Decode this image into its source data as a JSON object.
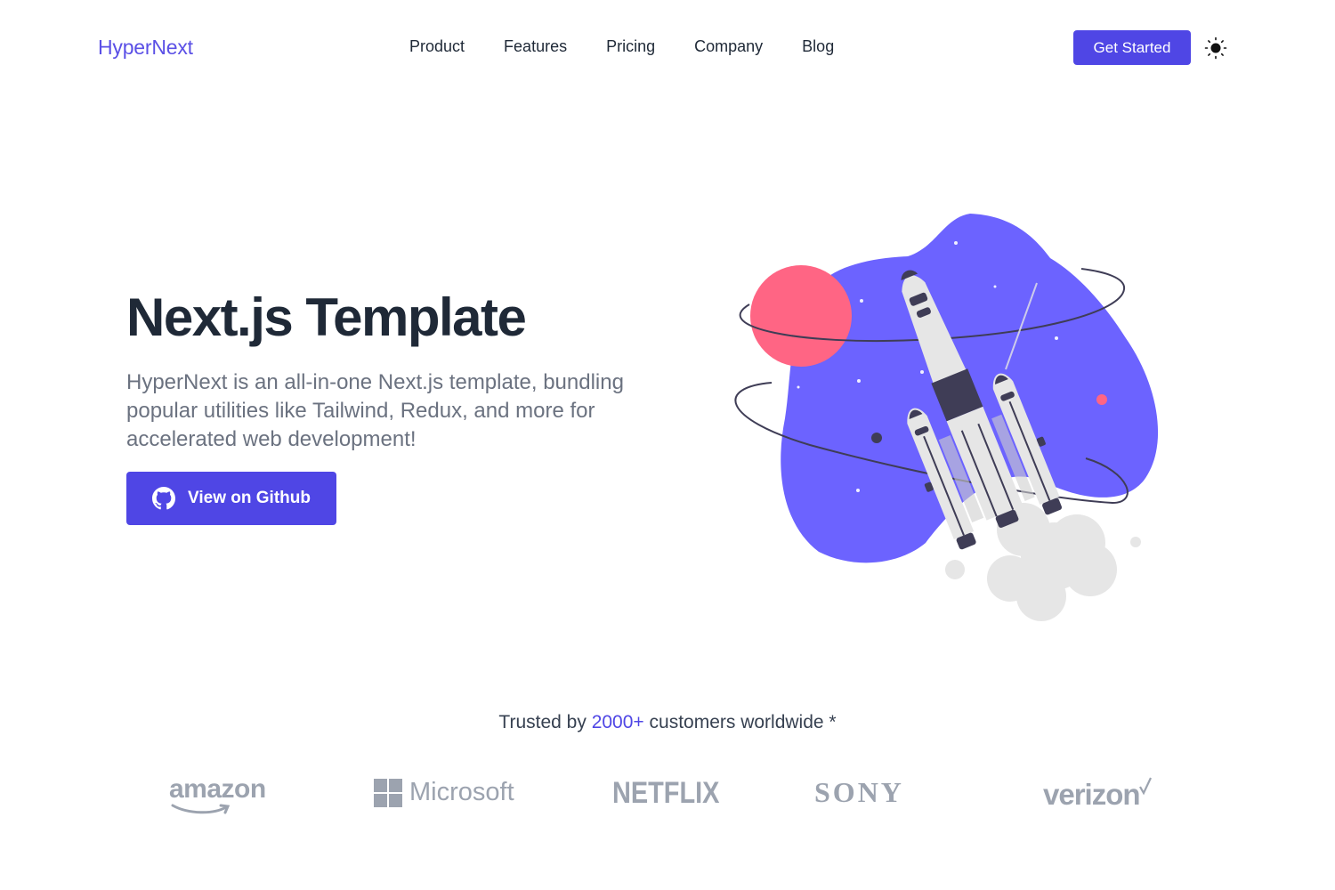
{
  "header": {
    "brand": "HyperNext",
    "nav": [
      "Product",
      "Features",
      "Pricing",
      "Company",
      "Blog"
    ],
    "cta_label": "Get Started",
    "theme_icon": "sun-icon"
  },
  "hero": {
    "title": "Next.js Template",
    "description": "HyperNext is an all-in-one Next.js template, bundling popular utilities like Tailwind, Redux, and more for accelerated web development!",
    "button_label": "View on Github",
    "button_icon": "github-icon",
    "illustration": "rocket-launch-illustration"
  },
  "trusted": {
    "prefix": "Trusted by",
    "count": "2000+",
    "suffix": "customers worldwide *"
  },
  "logos": {
    "amazon": "amazon",
    "microsoft": "Microsoft",
    "netflix": "NETFLIX",
    "sony": "SONY",
    "verizon": "verizon"
  },
  "colors": {
    "accent": "#4f46e5",
    "blob": "#6c63ff",
    "planet": "#ff6584",
    "text_dark": "#1f2937",
    "text_muted": "#6b7280",
    "logo_gray": "#9ca3af"
  }
}
